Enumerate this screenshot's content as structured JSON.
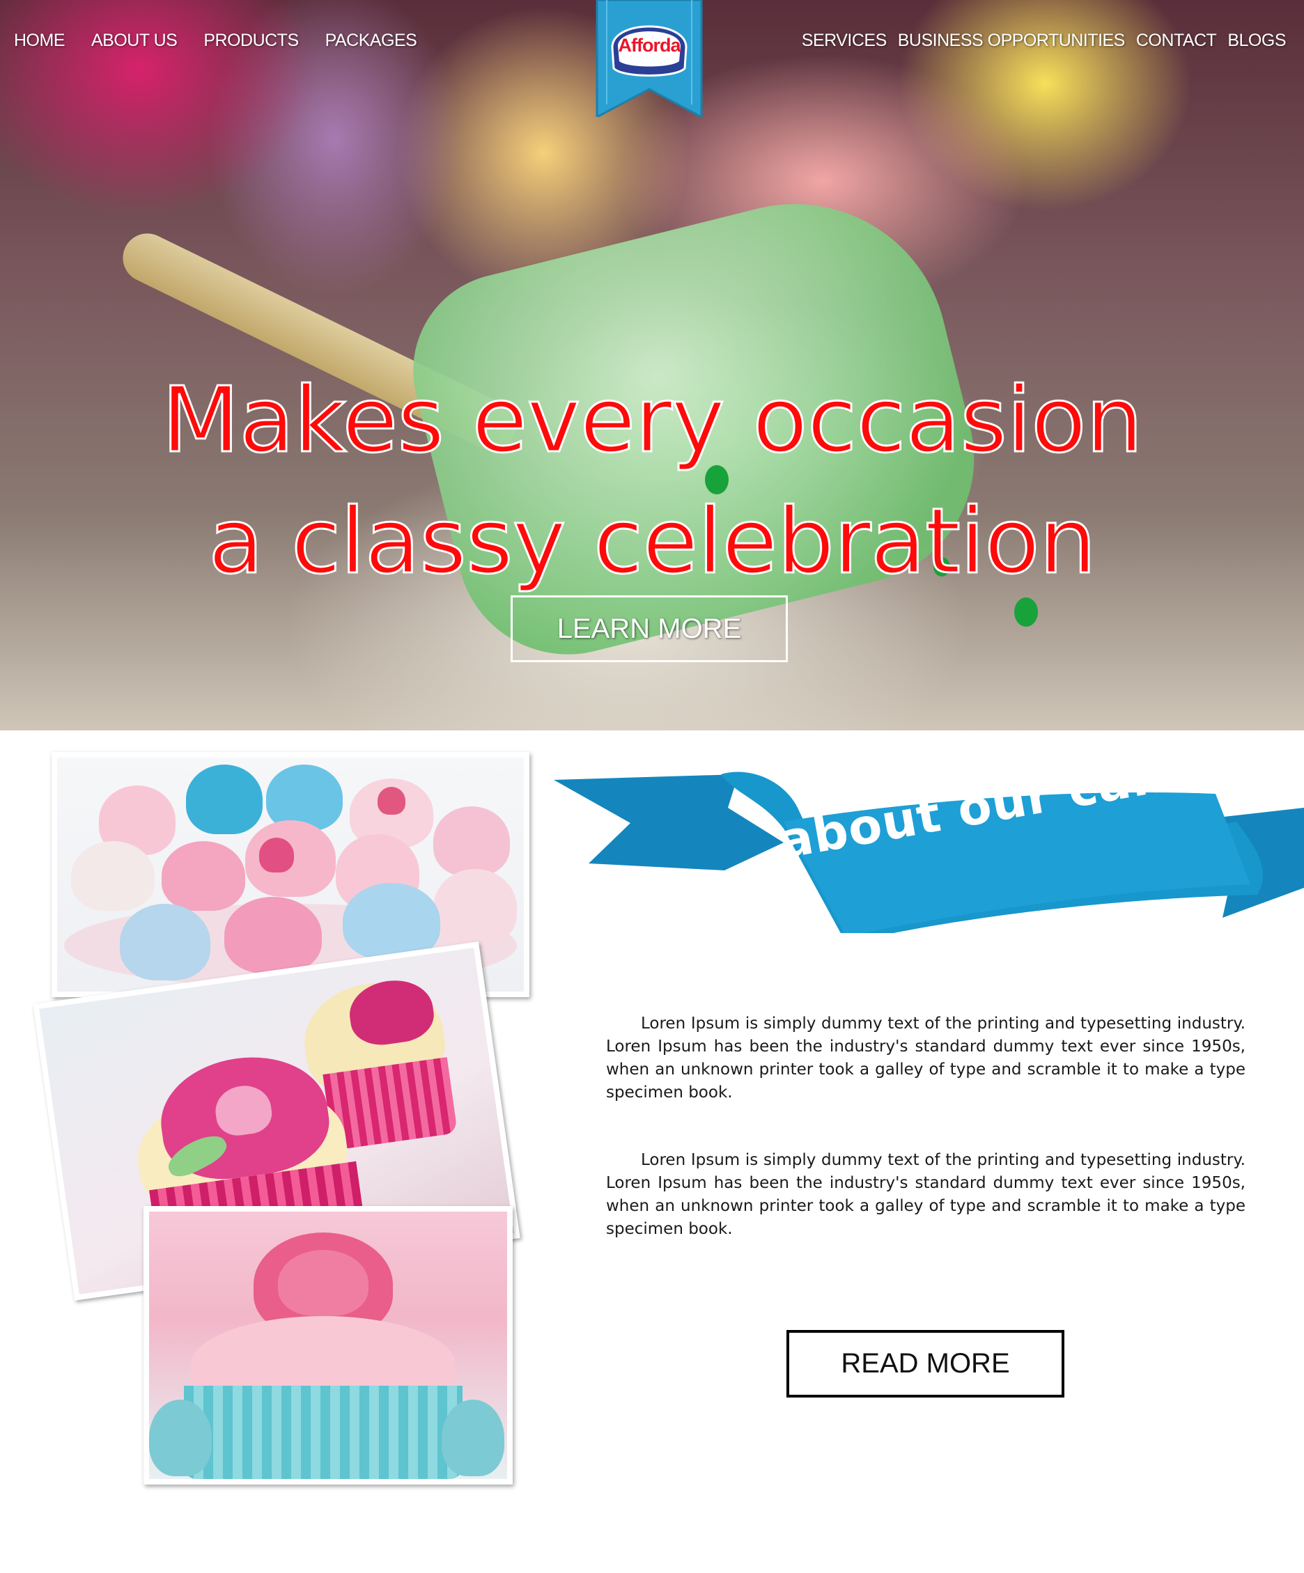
{
  "nav": {
    "left": [
      "HOME",
      "ABOUT US",
      "PRODUCTS",
      "PACKAGES"
    ],
    "right": [
      "SERVICES",
      "BUSINESS OPPORTUNITIES",
      "CONTACT",
      "BLOGS"
    ]
  },
  "logo": {
    "text": "Afforda",
    "ribbon_color": "#2aa0d2",
    "text_color": "#e8162b"
  },
  "hero": {
    "headline_line1": "Makes every occasion",
    "headline_line2": "a classy celebration",
    "cta_label": "LEARN MORE",
    "headline_color": "#ff0a0a"
  },
  "about": {
    "ribbon_title": "about our cakes",
    "ribbon_color": "#1797cc",
    "paragraphs": [
      "Loren Ipsum is simply dummy text of the printing and typesetting industry. Loren Ipsum has been the industry's standard dummy text ever since 1950s, when an unknown printer took a galley of type and scramble it to make a type specimen book.",
      "Loren Ipsum is simply dummy text of the printing and typesetting industry. Loren Ipsum has been the industry's standard dummy text ever since 1950s, when an unknown printer took a galley of type and scramble it to make a type specimen book."
    ],
    "cta_label": "READ MORE"
  },
  "images": [
    {
      "name": "cupcakes-assortment-photo"
    },
    {
      "name": "pink-flower-cupcakes-photo"
    },
    {
      "name": "rose-cupcake-photo"
    }
  ]
}
